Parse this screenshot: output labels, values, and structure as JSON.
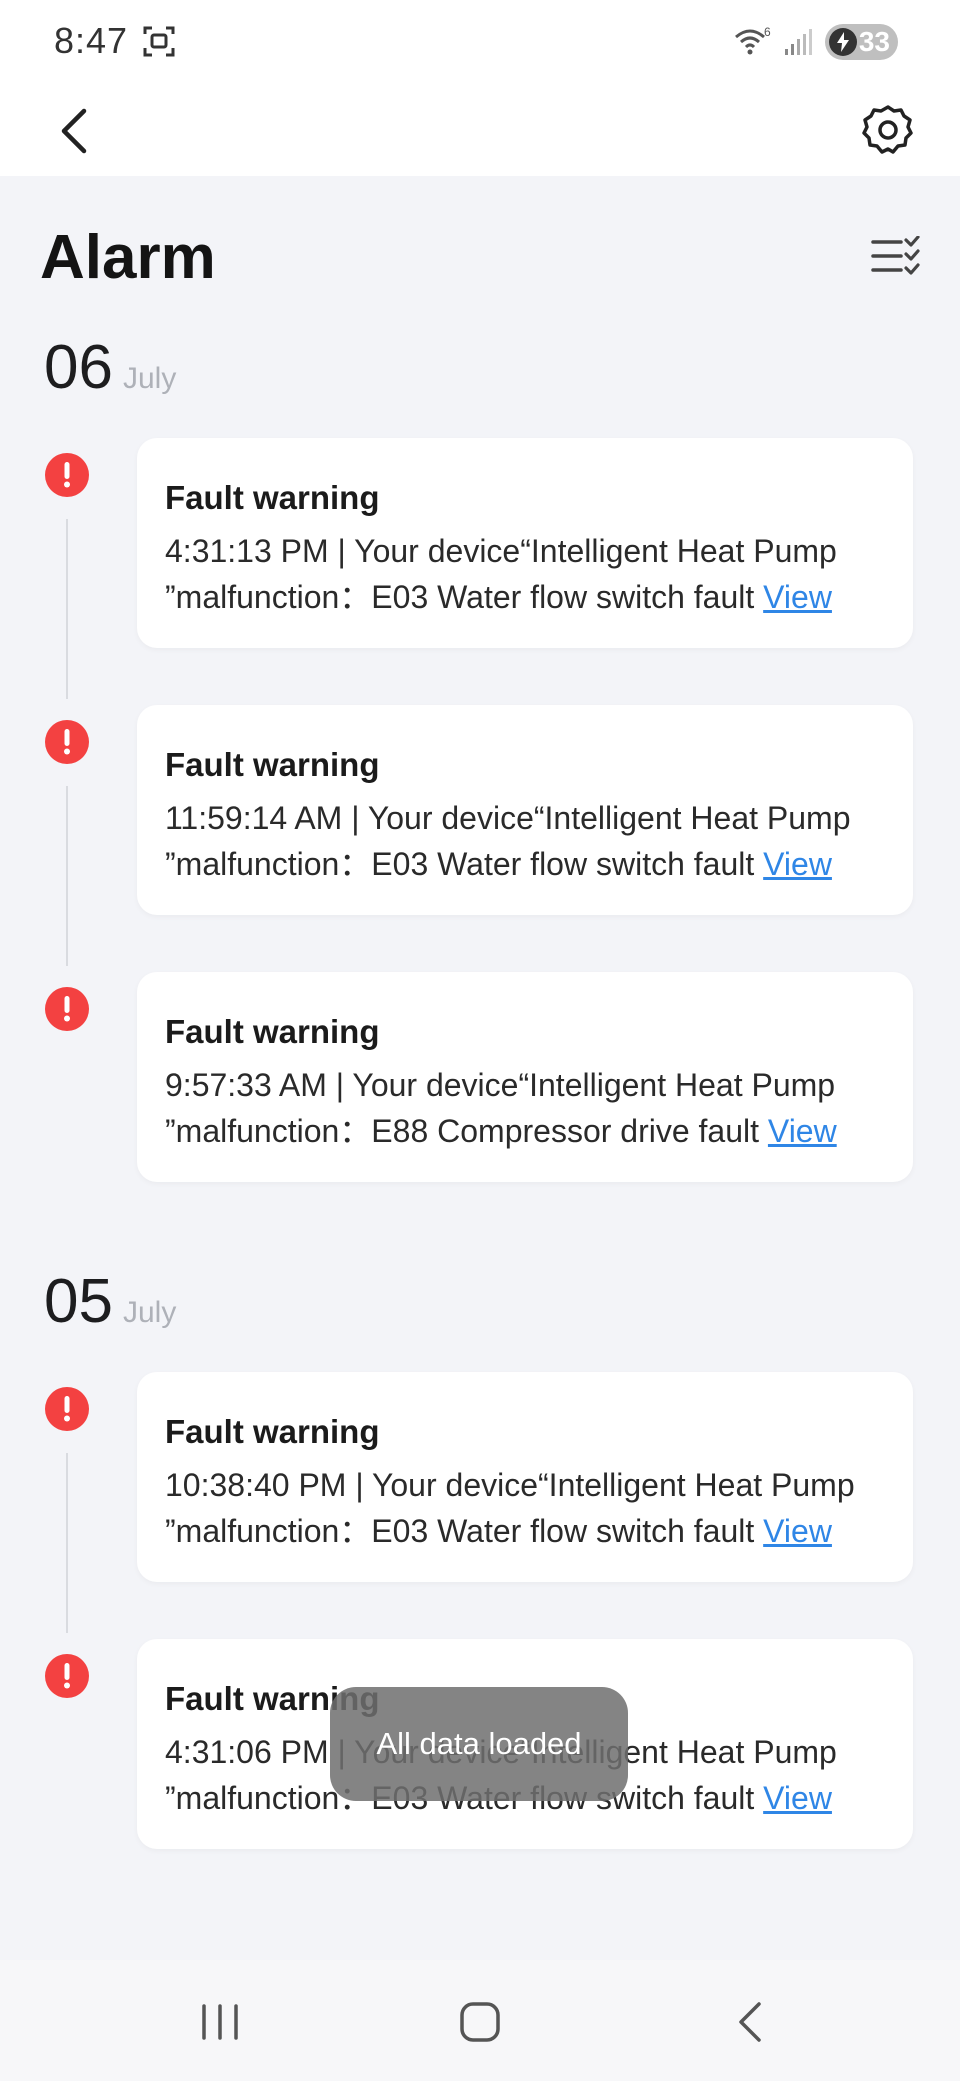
{
  "status_bar": {
    "time": "8:47",
    "battery": "33",
    "wifi_badge": "6"
  },
  "header": {
    "title": "Alarm"
  },
  "groups": [
    {
      "day": "06",
      "month": "July",
      "alarms": [
        {
          "title": "Fault warning",
          "line1": "4:31:13 PM | Your device“Intelligent Heat Pump",
          "line2": "”malfunction：E03 Water flow switch fault",
          "link": "View"
        },
        {
          "title": "Fault warning",
          "line1": "11:59:14 AM | Your device“Intelligent Heat Pump",
          "line2": "”malfunction：E03 Water flow switch fault",
          "link": "View"
        },
        {
          "title": "Fault warning",
          "line1": "9:57:33 AM | Your device“Intelligent Heat Pump",
          "line2": "”malfunction：E88 Compressor drive fault",
          "link": "View"
        }
      ]
    },
    {
      "day": "05",
      "month": "July",
      "alarms": [
        {
          "title": "Fault warning",
          "line1": "10:38:40 PM | Your device“Intelligent Heat Pump",
          "line2": "”malfunction：E03 Water flow switch fault",
          "link": "View"
        },
        {
          "title": "Fault warning",
          "line1": "4:31:06 PM | Your device“Intelligent Heat Pump",
          "line2": "”malfunction：E03 Water flow switch fault",
          "link": "View"
        }
      ]
    }
  ],
  "toast": "All data loaded",
  "colors": {
    "alert": "#f34141",
    "link": "#2f86e6",
    "background": "#f3f4f8"
  },
  "icons": {
    "back": "chevron-left-icon",
    "settings": "gear-icon",
    "filter": "checklist-icon",
    "alert": "exclamation-icon"
  }
}
